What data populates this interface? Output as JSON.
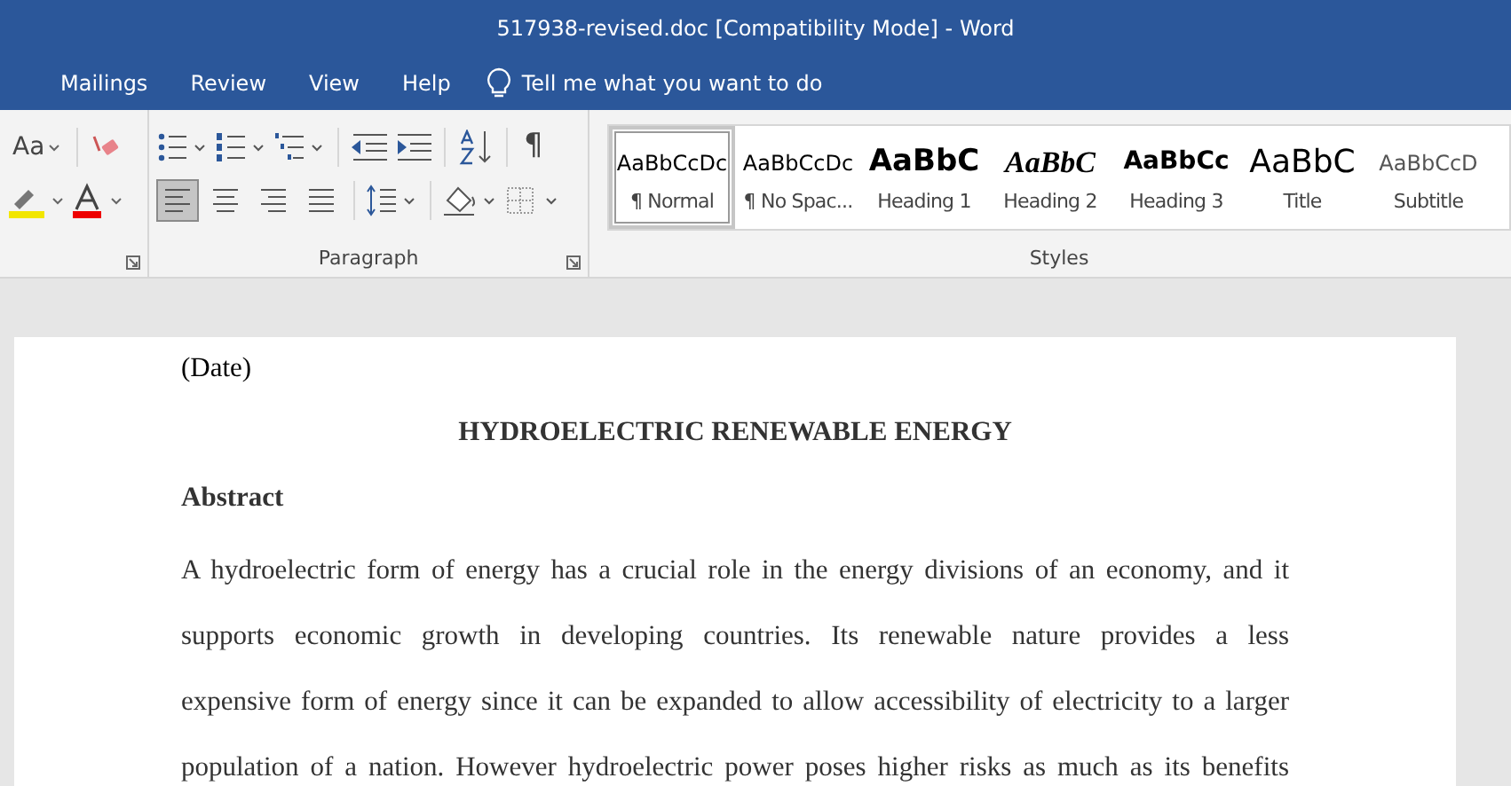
{
  "window": {
    "title": "517938-revised.doc [Compatibility Mode]  -  Word"
  },
  "ribbon_tabs": [
    {
      "label": "Mailings"
    },
    {
      "label": "Review"
    },
    {
      "label": "View"
    },
    {
      "label": "Help"
    }
  ],
  "tell_me": {
    "placeholder": "Tell me what you want to do"
  },
  "font_group": {
    "change_case": "Aa"
  },
  "paragraph_group": {
    "label": "Paragraph",
    "show_marks": "¶",
    "alignment": [
      {
        "kind": "left",
        "selected": true
      },
      {
        "kind": "center",
        "selected": false
      },
      {
        "kind": "right",
        "selected": false
      },
      {
        "kind": "justify",
        "selected": false
      }
    ]
  },
  "styles_group": {
    "label": "Styles",
    "styles": [
      {
        "kind": "normal",
        "preview": "AaBbCcDc",
        "name": "¶ Normal",
        "selected": true
      },
      {
        "kind": "normal",
        "preview": "AaBbCcDc",
        "name": "¶ No Spac...",
        "selected": false
      },
      {
        "kind": "heading1",
        "preview": "AaBbC",
        "name": "Heading 1",
        "selected": false
      },
      {
        "kind": "heading2",
        "preview": "AaBbC",
        "name": "Heading 2",
        "selected": false
      },
      {
        "kind": "heading3",
        "preview": "AaBbCc",
        "name": "Heading 3",
        "selected": false
      },
      {
        "kind": "title",
        "preview": "AaBbC",
        "name": "Title",
        "selected": false
      },
      {
        "kind": "subtitle",
        "preview": "AaBbCcD",
        "name": "Subtitle",
        "selected": false
      }
    ]
  },
  "document": {
    "date": "(Date)",
    "title": "HYDROELECTRIC RENEWABLE ENERGY",
    "section_heading": "Abstract",
    "paragraph_lines": [
      "A hydroelectric form of energy has a crucial role in the energy divisions of an economy, and it",
      "supports economic growth in developing countries. Its renewable nature provides a less",
      "expensive form of energy since it can be expanded to allow accessibility of electricity to a larger",
      "population of a nation. However hydroelectric power poses higher risks as much as its benefits"
    ]
  }
}
